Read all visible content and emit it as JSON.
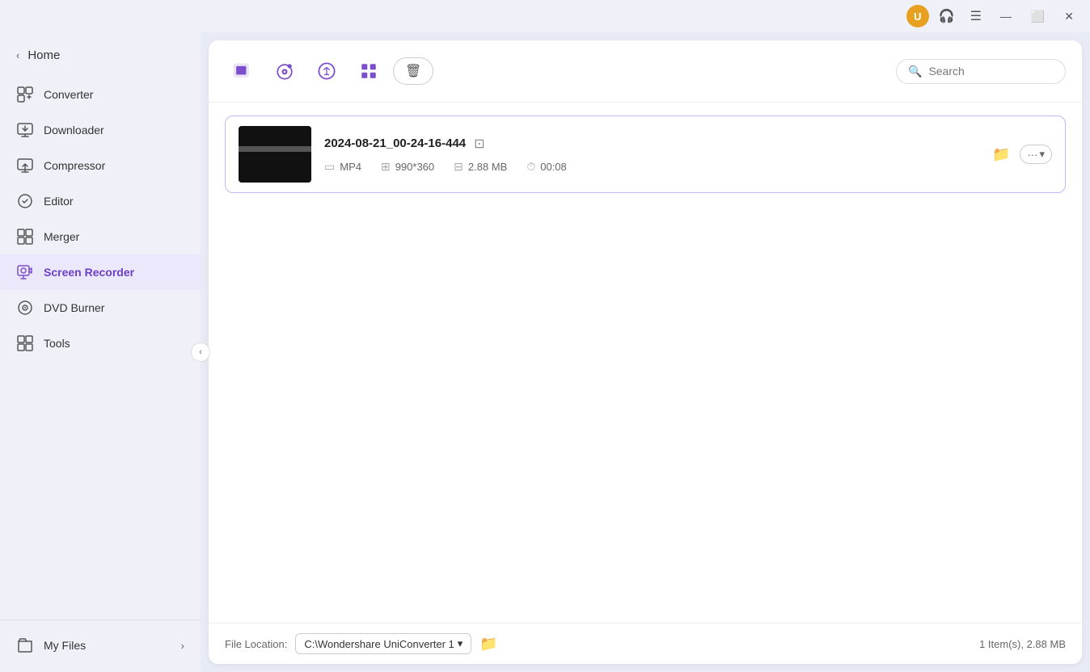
{
  "titlebar": {
    "avatar_label": "U",
    "avatar_bg": "#e8a020"
  },
  "sidebar": {
    "home_label": "Home",
    "collapse_icon": "‹",
    "items": [
      {
        "id": "converter",
        "label": "Converter",
        "icon": "converter"
      },
      {
        "id": "downloader",
        "label": "Downloader",
        "icon": "downloader"
      },
      {
        "id": "compressor",
        "label": "Compressor",
        "icon": "compressor"
      },
      {
        "id": "editor",
        "label": "Editor",
        "icon": "editor"
      },
      {
        "id": "merger",
        "label": "Merger",
        "icon": "merger"
      },
      {
        "id": "screen-recorder",
        "label": "Screen Recorder",
        "icon": "screen-recorder",
        "active": true
      },
      {
        "id": "dvd-burner",
        "label": "DVD Burner",
        "icon": "dvd-burner"
      },
      {
        "id": "tools",
        "label": "Tools",
        "icon": "tools"
      }
    ],
    "my_files_label": "My Files"
  },
  "toolbar": {
    "search_placeholder": "Search",
    "trash_icon": "🗑"
  },
  "recording": {
    "filename": "2024-08-21_00-24-16-444",
    "format": "MP4",
    "resolution": "990*360",
    "size": "2.88 MB",
    "duration": "00:08"
  },
  "footer": {
    "file_location_label": "File Location:",
    "file_location_path": "C:\\Wondershare UniConverter 1",
    "item_count": "1 Item(s), 2.88 MB"
  }
}
